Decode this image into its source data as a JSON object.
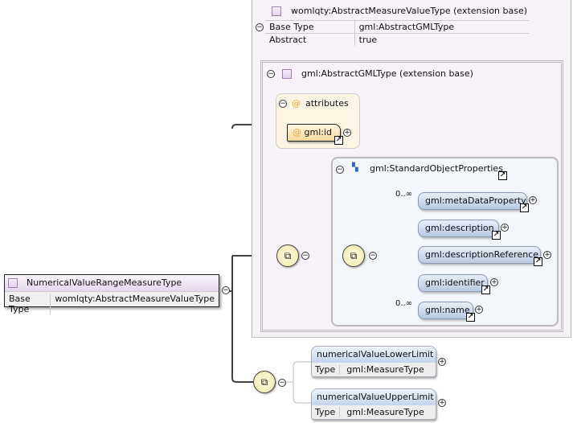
{
  "root": {
    "name": "NumericalValueRangeMeasureType",
    "base_type_label": "Base Type",
    "base_type": "womlqty:AbstractMeasureValueType"
  },
  "extension1": {
    "title": "womlqty:AbstractMeasureValueType (extension base)",
    "rows": [
      {
        "label": "Base Type",
        "value": "gml:AbstractGMLType"
      },
      {
        "label": "Abstract",
        "value": "true"
      }
    ]
  },
  "extension2": {
    "title": "gml:AbstractGMLType (extension base)"
  },
  "attributes": {
    "title": "attributes",
    "items": [
      "gml:id"
    ]
  },
  "group": {
    "title": "gml:StandardObjectProperties",
    "elements": [
      {
        "name": "gml:metaDataProperty",
        "occurs": "0..∞"
      },
      {
        "name": "gml:description",
        "occurs": ""
      },
      {
        "name": "gml:descriptionReference",
        "occurs": ""
      },
      {
        "name": "gml:identifier",
        "occurs": ""
      },
      {
        "name": "gml:name",
        "occurs": "0..∞"
      }
    ]
  },
  "elements": [
    {
      "name": "numericalValueLowerLimit",
      "type_label": "Type",
      "type": "gml:MeasureType"
    },
    {
      "name": "numericalValueUpperLimit",
      "type_label": "Type",
      "type": "gml:MeasureType"
    }
  ],
  "colors": {
    "type_icon": "#a07cb0",
    "attribute": "#e8a030",
    "element": "#c4d4ec",
    "sequence": "#f0e6a8"
  }
}
